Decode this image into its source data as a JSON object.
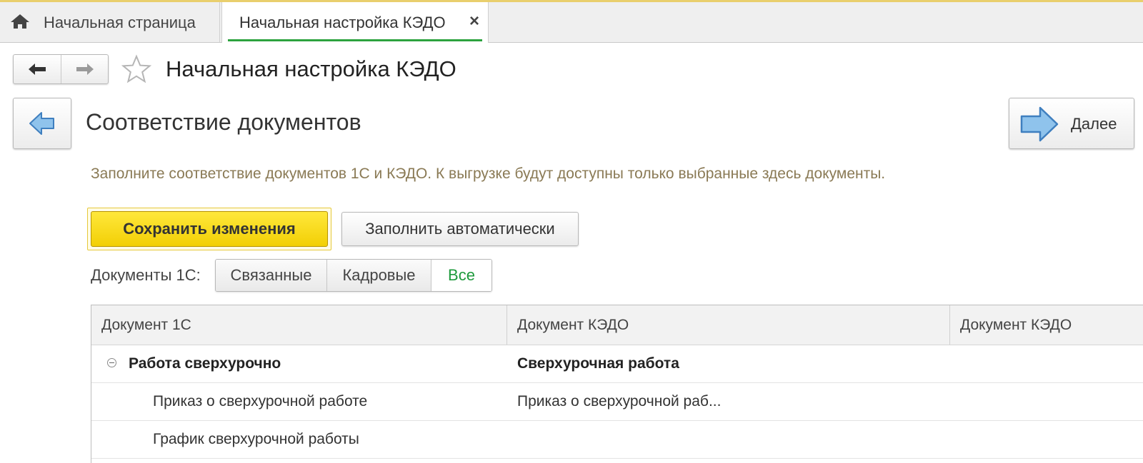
{
  "tabs": {
    "home_label": "Начальная страница",
    "active_label": "Начальная настройка КЭДО",
    "close_glyph": "×"
  },
  "header": {
    "title": "Начальная настройка КЭДО",
    "back_icon": "arrow-left-icon",
    "forward_icon": "arrow-right-icon",
    "favorite_icon": "star-icon"
  },
  "step": {
    "title": "Соответствие документов",
    "next_label": "Далее",
    "hint": "Заполните соответствие документов 1С и КЭДО. К выгрузке будут доступны только выбранные здесь документы."
  },
  "actions": {
    "save_label": "Сохранить изменения",
    "autofill_label": "Заполнить автоматически"
  },
  "filter": {
    "label": "Документы 1С:",
    "options": [
      "Связанные",
      "Кадровые",
      "Все"
    ],
    "selected": "Все"
  },
  "table": {
    "columns": [
      "Документ 1С",
      "Документ КЭДО",
      "Документ КЭДО"
    ],
    "rows": [
      {
        "doc1c": "Работа сверхурочно",
        "kedo": "Сверхурочная работа",
        "kedo2": "",
        "group": true
      },
      {
        "doc1c": "Приказ о сверхурочной работе",
        "kedo": "Приказ о сверхурочной раб...",
        "kedo2": "",
        "group": false
      },
      {
        "doc1c": "График сверхурочной работы",
        "kedo": "",
        "kedo2": "",
        "group": false
      }
    ]
  },
  "colors": {
    "accent_green": "#2ca33f",
    "save_button": "#f7d819",
    "hint_text": "#8a7a55",
    "selected_filter": "#1e9a3c"
  }
}
